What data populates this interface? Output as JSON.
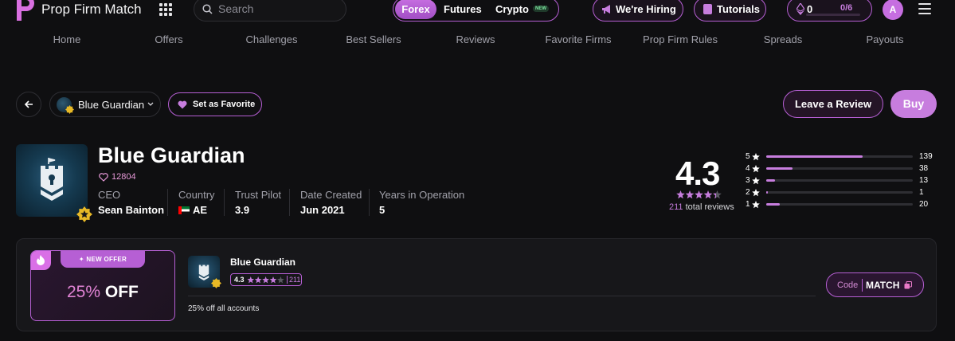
{
  "header": {
    "brand": "Prop Firm Match",
    "search_placeholder": "Search",
    "markets": [
      {
        "label": "Forex",
        "active": true
      },
      {
        "label": "Futures",
        "active": false
      },
      {
        "label": "Crypto",
        "active": false,
        "tag": "NEW"
      }
    ],
    "hiring_label": "We're Hiring",
    "tutorials_label": "Tutorials",
    "points": {
      "value": "0",
      "progress_label": "0/6",
      "progress": 0.0
    },
    "avatar_initial": "A"
  },
  "nav": [
    "Home",
    "Offers",
    "Challenges",
    "Best Sellers",
    "Reviews",
    "Favorite Firms",
    "Prop Firm Rules",
    "Spreads",
    "Payouts"
  ],
  "actions": {
    "firm_select_value": "Blue Guardian",
    "favorite_label": "Set as Favorite",
    "review_label": "Leave a Review",
    "buy_label": "Buy"
  },
  "firm": {
    "name": "Blue Guardian",
    "likes": "12804",
    "details": [
      {
        "label": "CEO",
        "value": "Sean Bainton"
      },
      {
        "label": "Country",
        "value": "AE"
      },
      {
        "label": "Trust Pilot",
        "value": "3.9"
      },
      {
        "label": "Date Created",
        "value": "Jun 2021"
      },
      {
        "label": "Years in Operation",
        "value": "5"
      }
    ]
  },
  "rating": {
    "score": "4.3",
    "total_count": "211",
    "total_suffix": "total reviews",
    "distribution": [
      {
        "stars": "5",
        "count": "139",
        "share": 0.66
      },
      {
        "stars": "4",
        "count": "38",
        "share": 0.18
      },
      {
        "stars": "3",
        "count": "13",
        "share": 0.06
      },
      {
        "stars": "2",
        "count": "1",
        "share": 0.01
      },
      {
        "stars": "1",
        "count": "20",
        "share": 0.09
      }
    ]
  },
  "offer": {
    "tag": "NEW OFFER",
    "percent": "25%",
    "off": "OFF",
    "firm_name": "Blue Guardian",
    "rating": "4.3",
    "review_count": "211",
    "description": "25% off all accounts",
    "code_label": "Code",
    "code_value": "MATCH"
  },
  "colors": {
    "accent": "#c77dde",
    "border_accent": "#b65fd4",
    "background": "#0f0f11"
  }
}
